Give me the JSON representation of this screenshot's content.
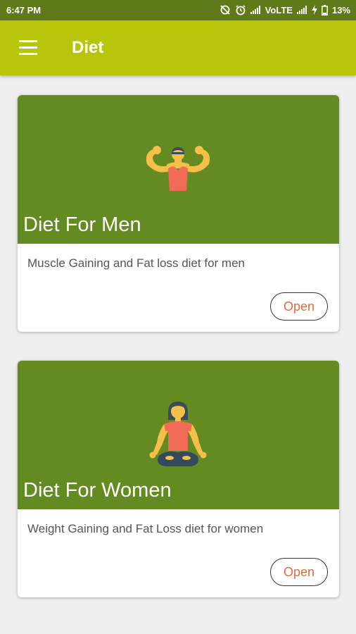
{
  "status_bar": {
    "time": "6:47 PM",
    "network": "VoLTE",
    "battery": "13%",
    "icons": [
      "sync-off-icon",
      "alarm-icon",
      "signal-icon",
      "signal-icon",
      "charging-icon",
      "battery-icon"
    ]
  },
  "app_bar": {
    "title": "Diet",
    "menu_icon": "hamburger-menu-icon",
    "color": "#b9c50a"
  },
  "cards": [
    {
      "title": "Diet For Men",
      "description": "Muscle Gaining and Fat loss diet for men",
      "button_label": "Open",
      "illustration": "bodybuilder-icon"
    },
    {
      "title": "Diet For Women",
      "description": "Weight Gaining and Fat Loss diet for women",
      "button_label": "Open",
      "illustration": "yoga-woman-icon"
    }
  ],
  "colors": {
    "card_header": "#648a22",
    "button_text": "#e06b3a"
  }
}
